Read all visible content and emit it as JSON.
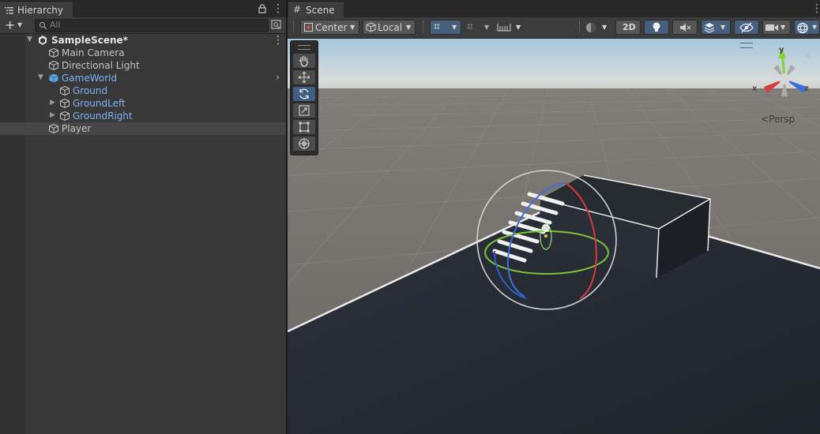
{
  "hierarchy": {
    "tab_label": "Hierarchy",
    "search_placeholder": "All",
    "scene_name": "SampleScene*",
    "items": [
      {
        "label": "Main Camera"
      },
      {
        "label": "Directional Light"
      },
      {
        "label": "GameWorld"
      },
      {
        "label": "Ground"
      },
      {
        "label": "GroundLeft"
      },
      {
        "label": "GroundRight"
      },
      {
        "label": "Player"
      }
    ]
  },
  "scene": {
    "tab_label": "Scene",
    "pivot_label": "Center",
    "space_label": "Local",
    "mode_2d_label": "2D",
    "persp_label": "Persp",
    "gizmo_x": "x",
    "gizmo_y": "y",
    "gizmo_z": "z"
  },
  "colors": {
    "accent_blue": "#7eb3f5",
    "gizmo_x": "#d04040",
    "gizmo_y": "#86d23a",
    "gizmo_z": "#3e6fd8"
  },
  "icons": [
    "hierarchy-list-icon",
    "lock-icon",
    "more-icon",
    "add-icon",
    "search-icon",
    "scene-settings-icon",
    "unity-scene-icon",
    "cube-icon",
    "prefab-icon",
    "expand-arrow-icon",
    "grid-icon",
    "pivot-icon",
    "space-icon",
    "grid-snap-icon",
    "increment-snap-icon",
    "ruler-icon",
    "shading-mode-icon",
    "light-icon",
    "audio-icon",
    "effects-icon",
    "visibility-icon",
    "camera-icon",
    "gizmo-icon",
    "hand-tool-icon",
    "move-tool-icon",
    "rotate-tool-icon",
    "scale-tool-icon",
    "rect-tool-icon",
    "transform-tool-icon"
  ]
}
